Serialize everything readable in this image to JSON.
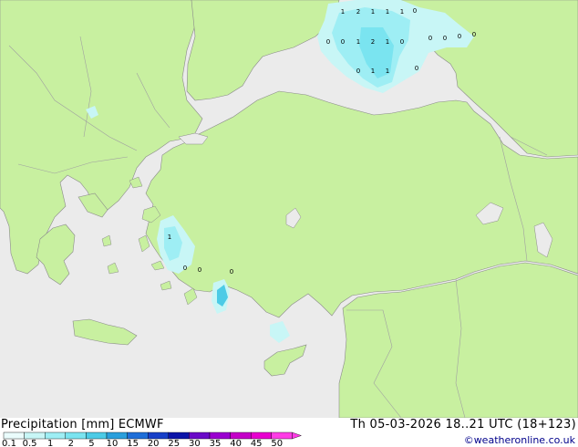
{
  "header": {
    "title": "Precipitation [mm]",
    "model": "ECMWF",
    "valid": "Th 05-03-2026 18..21 UTC (18+123)"
  },
  "credit": "©weatheronline.co.uk",
  "colors": {
    "sea": "#ebebeb",
    "land": "#c8f0a0",
    "border": "#a0a0a0",
    "coast": "#8a8a8a"
  },
  "legend": {
    "ticks": [
      "0.1",
      "0.5",
      "1",
      "2",
      "5",
      "10",
      "15",
      "20",
      "25",
      "30",
      "35",
      "40",
      "45",
      "50"
    ],
    "colors": [
      "#eafcfc",
      "#c8f6f6",
      "#9eeef4",
      "#7ae4f0",
      "#4ccbe6",
      "#2a9fdc",
      "#1e6ed8",
      "#1840c8",
      "#0c14a8",
      "#6a0ac8",
      "#9a00d0",
      "#c400c8",
      "#e800d0",
      "#ff3ce6"
    ]
  },
  "point_values": {
    "black_sea_row1": [
      "1",
      "2",
      "1",
      "1",
      "1",
      "0"
    ],
    "black_sea_row2": [
      "0",
      "0",
      "1",
      "2",
      "1",
      "0"
    ],
    "black_sea_row3": [
      "0",
      "0",
      "0",
      "0"
    ],
    "black_sea_row4": [
      "0",
      "1",
      "1",
      "0"
    ],
    "aegean": [
      "1",
      "0",
      "0",
      "0"
    ]
  }
}
